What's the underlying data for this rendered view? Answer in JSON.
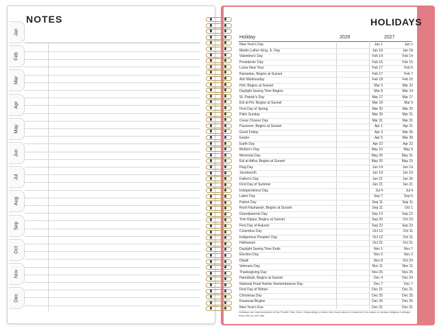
{
  "left_page": {
    "title": "NOTES",
    "months": [
      "Jan",
      "Feb",
      "Mar",
      "Apr",
      "May",
      "Jun",
      "Jul",
      "Aug",
      "Sep",
      "Oct",
      "Nov",
      "Dec"
    ]
  },
  "right_page": {
    "title": "HOLIDAYS",
    "col_holiday": "Holiday",
    "col_2026": "2026",
    "col_2027": "2027",
    "rows": [
      [
        "New Year's Day",
        "Jan 1",
        "Jan 1"
      ],
      [
        "Martin Luther King, Jr. Day",
        "Jan 19",
        "Jan 18"
      ],
      [
        "Valentine's Day",
        "Feb 14",
        "Feb 14"
      ],
      [
        "Presidents' Day",
        "Feb 16",
        "Feb 15"
      ],
      [
        "Lunar New Year",
        "Feb 17",
        "Feb 6"
      ],
      [
        "Ramadan, Begins at Sunset",
        "Feb 17",
        "Feb 7"
      ],
      [
        "Ash Wednesday",
        "Feb 18",
        "Feb 10"
      ],
      [
        "Holi, Begins at Sunset",
        "Mar 3",
        "Mar 22"
      ],
      [
        "Daylight Saving Time Begins",
        "Mar 8",
        "Mar 14"
      ],
      [
        "St. Patrick's Day",
        "Mar 17",
        "Mar 17"
      ],
      [
        "Eid al-Fitr, Begins at Sunset",
        "Mar 19",
        "Mar 9"
      ],
      [
        "First Day of Spring",
        "Mar 20",
        "Mar 20"
      ],
      [
        "Palm Sunday",
        "Mar 29",
        "Mar 21"
      ],
      [
        "Cesar Chavez Day",
        "Mar 31",
        "Mar 31"
      ],
      [
        "Passover, Begins at Sunset",
        "Apr 1",
        "Apr 21"
      ],
      [
        "Good Friday",
        "Apr 3",
        "Mar 26"
      ],
      [
        "Easter",
        "Apr 5",
        "Mar 28"
      ],
      [
        "Earth Day",
        "Apr 22",
        "Apr 22"
      ],
      [
        "Mother's Day",
        "May 10",
        "May 9"
      ],
      [
        "Memorial Day",
        "May 25",
        "May 31"
      ],
      [
        "Eid al-Adha, Begins at Sunset",
        "May 26",
        "May 15"
      ],
      [
        "Flag Day",
        "Jun 14",
        "Jun 14"
      ],
      [
        "Juneteenth",
        "Jun 19",
        "Jun 19"
      ],
      [
        "Father's Day",
        "Jun 21",
        "Jun 20"
      ],
      [
        "First Day of Summer",
        "Jun 21",
        "Jun 21"
      ],
      [
        "Independence Day",
        "Jul 4",
        "Jul 4"
      ],
      [
        "Labor Day",
        "Sep 7",
        "Sep 6"
      ],
      [
        "Patriot Day",
        "Sep 11",
        "Sep 11"
      ],
      [
        "Rosh Hashanah, Begins at Sunset",
        "Sep 11",
        "Oct 1"
      ],
      [
        "Grandparents Day",
        "Sep 13",
        "Sep 12"
      ],
      [
        "Yom Kippur, Begins at Sunset",
        "Sep 20",
        "Oct 10"
      ],
      [
        "First Day of Autumn",
        "Sep 22",
        "Sep 23"
      ],
      [
        "Columbus Day",
        "Oct 12",
        "Oct 11"
      ],
      [
        "Indigenous Peoples' Day",
        "Oct 12",
        "Oct 11"
      ],
      [
        "Halloween",
        "Oct 31",
        "Oct 31"
      ],
      [
        "Daylight Saving Time Ends",
        "Nov 1",
        "Nov 7"
      ],
      [
        "Election Day",
        "Nov 3",
        "Nov 2"
      ],
      [
        "Diwali",
        "Nov 8",
        "Oct 29"
      ],
      [
        "Veterans Day",
        "Nov 11",
        "Nov 11"
      ],
      [
        "Thanksgiving Day",
        "Nov 26",
        "Nov 25"
      ],
      [
        "Hanukkah, Begins at Sunset",
        "Dec 4",
        "Dec 24"
      ],
      [
        "National Pearl Harbor Remembrance Day",
        "Dec 7",
        "Dec 7"
      ],
      [
        "First Day of Winter",
        "Dec 21",
        "Dec 21"
      ],
      [
        "Christmas Day",
        "Dec 25",
        "Dec 25"
      ],
      [
        "Kwanzaa Begins",
        "Dec 26",
        "Dec 26"
      ],
      [
        "New Year's Eve",
        "Dec 31",
        "Dec 31"
      ]
    ],
    "footnote": "Holidays are representative of the Pacific Time Zone. Depending on when the moon above is observed, the dates of certain religious holidays may vary by one day."
  },
  "colors": {
    "cover": "#e27d85",
    "spiral_wire": "#b59a5a"
  }
}
